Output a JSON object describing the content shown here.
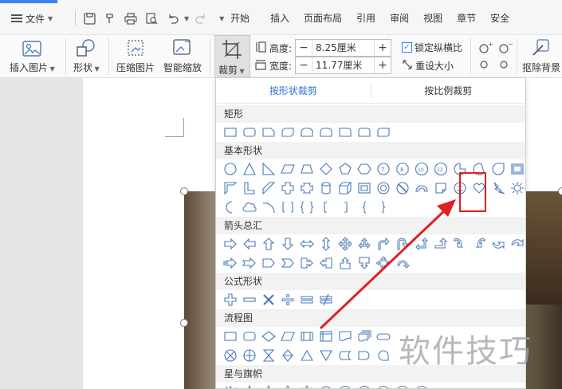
{
  "menubar": {
    "file_label": "文件",
    "tabs": [
      "开始",
      "插入",
      "页面布局",
      "引用",
      "审阅",
      "视图",
      "章节",
      "安全"
    ]
  },
  "ribbon": {
    "insert_picture": "插入图片",
    "shape": "形状",
    "compress": "压缩图片",
    "smart_zoom": "智能缩放",
    "crop": "裁剪",
    "height_label": "高度:",
    "height_value": "8.25厘米",
    "width_label": "宽度:",
    "width_value": "11.77厘米",
    "lock_ratio": "锁定纵横比",
    "lock_checked": true,
    "reset_size": "重设大小",
    "remove_bg": "抠除背景"
  },
  "crop_menu": {
    "tab_shape": "按形状裁剪",
    "tab_ratio": "按比例裁剪",
    "sections": {
      "rect": "矩形",
      "basic": "基本形状",
      "arrows": "箭头总汇",
      "formula": "公式形状",
      "flowchart": "流程图",
      "stars": "星与旗帜"
    }
  },
  "watermark": "软件技巧",
  "colors": {
    "accent": "#3c7ef7",
    "highlight": "#e02020",
    "shape_stroke": "#4a7ab8"
  }
}
